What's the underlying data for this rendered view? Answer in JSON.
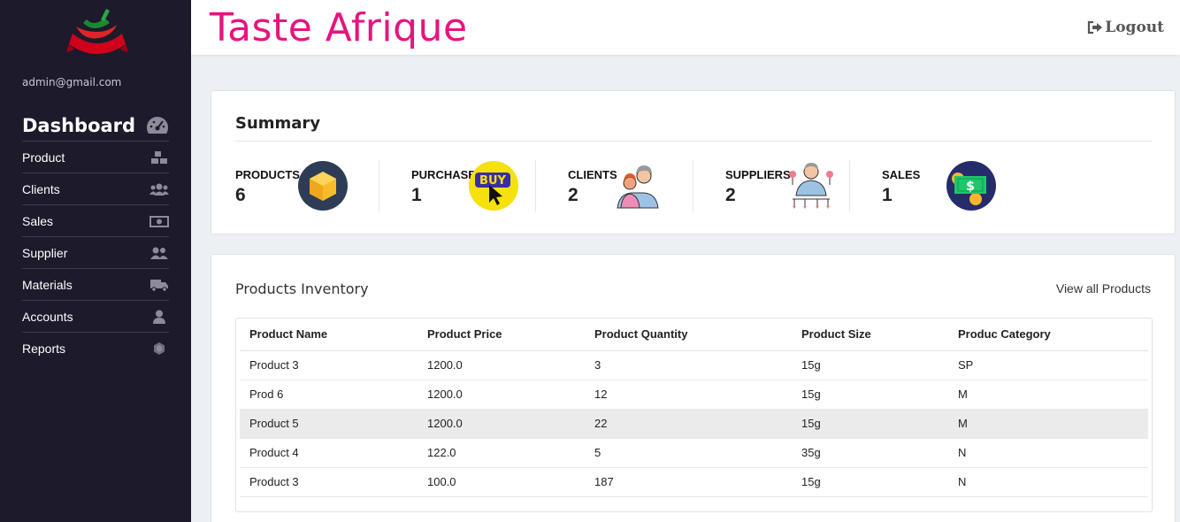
{
  "sidebar": {
    "email": "admin@gmail.com",
    "dashboard_label": "Dashboard",
    "items": [
      {
        "label": "Product",
        "icon": "boxes-icon"
      },
      {
        "label": "Clients",
        "icon": "users-icon"
      },
      {
        "label": "Sales",
        "icon": "money-bill-icon"
      },
      {
        "label": "Supplier",
        "icon": "user-friends-icon"
      },
      {
        "label": "Materials",
        "icon": "truck-icon"
      },
      {
        "label": "Accounts",
        "icon": "user-icon"
      },
      {
        "label": "Reports",
        "icon": "hexagon-icon"
      }
    ]
  },
  "header": {
    "brand": "Taste Afrique",
    "logout_label": "Logout"
  },
  "summary": {
    "title": "Summary",
    "stats": [
      {
        "label": "PRODUCTS",
        "value": "6"
      },
      {
        "label": "PURCHASE",
        "value": "1",
        "badge": "BUY"
      },
      {
        "label": "CLIENTS",
        "value": "2"
      },
      {
        "label": "SUPPLIERS",
        "value": "2"
      },
      {
        "label": "SALES",
        "value": "1",
        "badge": "$"
      }
    ]
  },
  "inventory": {
    "title": "Products Inventory",
    "view_all": "View all Products",
    "columns": [
      "Product Name",
      "Product Price",
      "Product Quantity",
      "Product Size",
      "Produc Category"
    ],
    "rows": [
      [
        "Product 3",
        "1200.0",
        "3",
        "15g",
        "SP"
      ],
      [
        "Prod 6",
        "1200.0",
        "12",
        "15g",
        "M"
      ],
      [
        "Product 5",
        "1200.0",
        "22",
        "15g",
        "M"
      ],
      [
        "Product 4",
        "122.0",
        "5",
        "35g",
        "N"
      ],
      [
        "Product 3",
        "100.0",
        "187",
        "15g",
        "N"
      ]
    ]
  },
  "colors": {
    "sidebar_bg": "#1c1a2b",
    "brand": "#e6147f",
    "page_bg": "#eceff3"
  }
}
